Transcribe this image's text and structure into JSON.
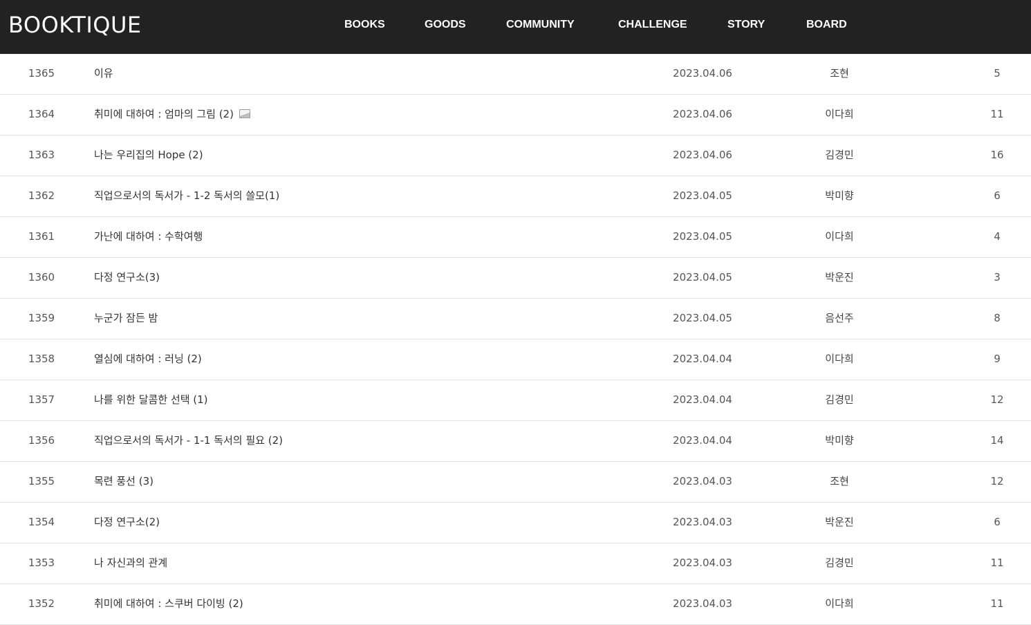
{
  "header": {
    "logo": "BOOKTIQUE",
    "nav": [
      "BOOKS",
      "GOODS",
      "COMMUNITY",
      "CHALLENGE",
      "STORY",
      "BOARD"
    ]
  },
  "colors": {
    "header_bg": "#222222",
    "header_text": "#ffffff",
    "row_border": "#e3e3e3",
    "text": "#333333"
  },
  "posts": [
    {
      "num": "1365",
      "title": "이유",
      "date": "2023.04.06",
      "author": "조현",
      "views": "5",
      "has_image": false
    },
    {
      "num": "1364",
      "title": "취미에 대하여 : 엄마의 그림 (2)",
      "date": "2023.04.06",
      "author": "이다희",
      "views": "11",
      "has_image": true
    },
    {
      "num": "1363",
      "title": "나는 우리집의 Hope (2)",
      "date": "2023.04.06",
      "author": "김경민",
      "views": "16",
      "has_image": false
    },
    {
      "num": "1362",
      "title": "직업으로서의 독서가 - 1-2 독서의 쓸모(1)",
      "date": "2023.04.05",
      "author": "박미향",
      "views": "6",
      "has_image": false
    },
    {
      "num": "1361",
      "title": "가난에 대하여 : 수학여행",
      "date": "2023.04.05",
      "author": "이다희",
      "views": "4",
      "has_image": false
    },
    {
      "num": "1360",
      "title": "다정 연구소(3)",
      "date": "2023.04.05",
      "author": "박운진",
      "views": "3",
      "has_image": false
    },
    {
      "num": "1359",
      "title": "누군가 잠든 밤",
      "date": "2023.04.05",
      "author": "음선주",
      "views": "8",
      "has_image": false
    },
    {
      "num": "1358",
      "title": "열심에 대하여 : 러닝 (2)",
      "date": "2023.04.04",
      "author": "이다희",
      "views": "9",
      "has_image": false
    },
    {
      "num": "1357",
      "title": "나를 위한 달콤한 선택 (1)",
      "date": "2023.04.04",
      "author": "김경민",
      "views": "12",
      "has_image": false
    },
    {
      "num": "1356",
      "title": "직업으로서의 독서가 - 1-1 독서의 필요 (2)",
      "date": "2023.04.04",
      "author": "박미향",
      "views": "14",
      "has_image": false
    },
    {
      "num": "1355",
      "title": "목련 풍선 (3)",
      "date": "2023.04.03",
      "author": "조현",
      "views": "12",
      "has_image": false
    },
    {
      "num": "1354",
      "title": "다정 연구소(2)",
      "date": "2023.04.03",
      "author": "박운진",
      "views": "6",
      "has_image": false
    },
    {
      "num": "1353",
      "title": "나 자신과의 관계",
      "date": "2023.04.03",
      "author": "김경민",
      "views": "11",
      "has_image": false
    },
    {
      "num": "1352",
      "title": "취미에 대하여 : 스쿠버 다이빙 (2)",
      "date": "2023.04.03",
      "author": "이다희",
      "views": "11",
      "has_image": false
    }
  ]
}
